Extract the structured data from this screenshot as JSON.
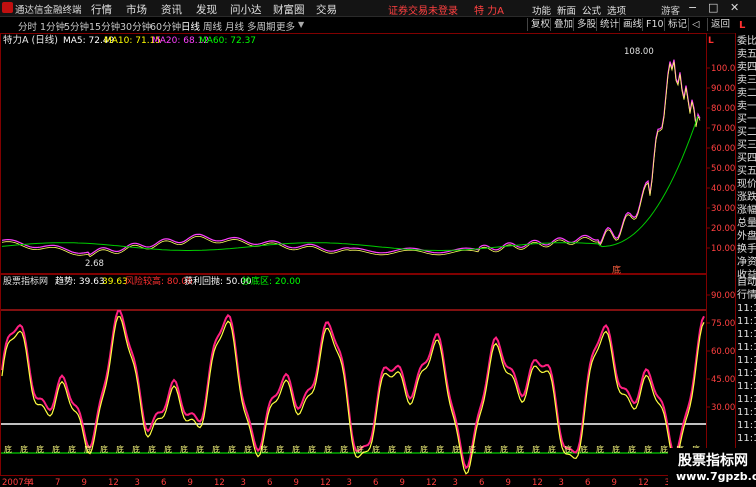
{
  "titlebar": {
    "app_name": "通达信金融终端",
    "menu": [
      "行情",
      "市场",
      "资讯",
      "发现",
      "问小达",
      "财富圈",
      "交易"
    ],
    "alert": "证券交易未登录",
    "stock_label": "特 力A",
    "right_menu": [
      "功能",
      "新面",
      "公式",
      "选项"
    ],
    "user": "游客"
  },
  "toolbar": {
    "periods": [
      "分时",
      "1分钟",
      "5分钟",
      "15分钟",
      "30分钟",
      "60分钟",
      "日线",
      "周线",
      "月线",
      "多周期",
      "更多"
    ],
    "active_period": "日线",
    "buttons": [
      "复权",
      "叠加",
      "多股",
      "统计",
      "画线",
      "F10",
      "标记",
      "◁",
      "返回"
    ]
  },
  "main_chart": {
    "stock_title": "特力A (日线)",
    "ma": [
      {
        "label": "MA5: 72.49",
        "color": "#ffffff"
      },
      {
        "label": "MA10: 71.15",
        "color": "#ffff00"
      },
      {
        "label": "MA20: 68.12",
        "color": "#ff00ff"
      },
      {
        "label": "MA60: 72.37",
        "color": "#00ff00"
      }
    ],
    "y_ticks": [
      "100.0",
      "90.00",
      "80.00",
      "70.00",
      "60.00",
      "50.00",
      "40.00",
      "30.00",
      "20.00",
      "10.00"
    ],
    "high_label": "108.00",
    "low_label": "2.68",
    "side_marker": "L",
    "bottom_tag": "底"
  },
  "indicator": {
    "name": "股票指标网",
    "params": [
      {
        "text": "趋势: 39.63",
        "color": "#ffffff"
      },
      {
        "text": "39.63",
        "color": "#ffff00"
      },
      {
        "text": "风险较高: 80.00",
        "color": "#ff3030"
      },
      {
        "text": "获利回抛: 50.00",
        "color": "#ffffff"
      },
      {
        "text": "抄底区: 20.00",
        "color": "#00ff00"
      }
    ],
    "y_ticks": [
      "90.00",
      "75.00",
      "60.00",
      "45.00",
      "30.00"
    ],
    "bottom_marker": "底"
  },
  "date_axis": [
    "2007年",
    "4",
    "7",
    "9",
    "12",
    "3",
    "6",
    "9",
    "12",
    "3",
    "6",
    "9",
    "12",
    "3",
    "6",
    "9",
    "12",
    "3",
    "6",
    "9",
    "12",
    "3",
    "6",
    "9",
    "12",
    "3",
    "7"
  ],
  "right_panel": {
    "top_marker": "L",
    "items": [
      "委比",
      "卖五",
      "卖四",
      "卖三",
      "卖二",
      "卖一",
      "买一",
      "买二",
      "买三",
      "买四",
      "买五",
      "现价",
      "涨跌",
      "涨幅",
      "总量",
      "外盘",
      "换手",
      "净资",
      "收益"
    ],
    "lower_items": [
      "自动",
      "行情",
      "11:1",
      "11:1",
      "11:1",
      "11:1",
      "11:1",
      "11:1",
      "11:1",
      "11:1",
      "11:1",
      "11:1",
      "11:1"
    ]
  },
  "watermark": {
    "line1": "股票指标网",
    "line2": "www.7gpzb.com"
  }
}
